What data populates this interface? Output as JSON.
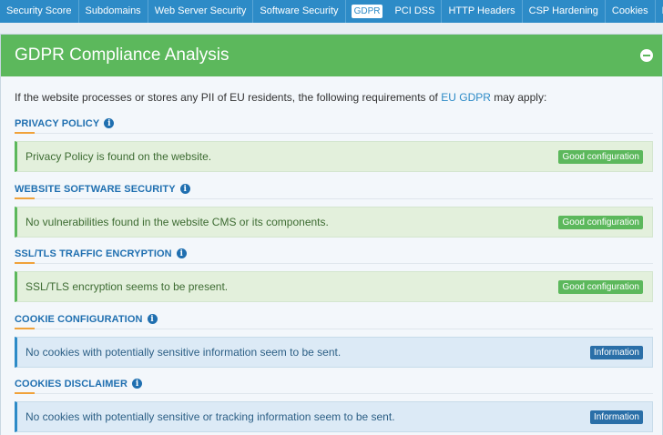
{
  "nav": [
    {
      "label": "Security Score",
      "active": false
    },
    {
      "label": "Subdomains",
      "active": false
    },
    {
      "label": "Web Server Security",
      "active": false
    },
    {
      "label": "Software Security",
      "active": false
    },
    {
      "label": "GDPR",
      "active": true
    },
    {
      "label": "PCI DSS",
      "active": false
    },
    {
      "label": "HTTP Headers",
      "active": false
    },
    {
      "label": "CSP Hardening",
      "active": false
    },
    {
      "label": "Cookies",
      "active": false
    },
    {
      "label": "External Content",
      "active": false
    }
  ],
  "panel": {
    "title": "GDPR Compliance Analysis",
    "intro_before": "If the website processes or stores any PII of EU residents, the following requirements of ",
    "intro_link": "EU GDPR",
    "intro_after": " may apply:"
  },
  "sections": [
    {
      "title": "PRIVACY POLICY",
      "text": "Privacy Policy is found on the website.",
      "badge": "Good configuration",
      "kind": "good"
    },
    {
      "title": "WEBSITE SOFTWARE SECURITY",
      "text": "No vulnerabilities found in the website CMS or its components.",
      "badge": "Good configuration",
      "kind": "good"
    },
    {
      "title": "SSL/TLS TRAFFIC ENCRYPTION",
      "text": "SSL/TLS encryption seems to be present.",
      "badge": "Good configuration",
      "kind": "good"
    },
    {
      "title": "COOKIE CONFIGURATION",
      "text": "No cookies with potentially sensitive information seem to be sent.",
      "badge": "Information",
      "kind": "info"
    },
    {
      "title": "COOKIES DISCLAIMER",
      "text": "No cookies with potentially sensitive or tracking information seem to be sent.",
      "badge": "Information",
      "kind": "info"
    }
  ],
  "colors": {
    "nav": "#2d8bc7",
    "header": "#5cb85c",
    "good": "#5cb85c",
    "info": "#2a6fa8",
    "accent": "#f0a23a"
  },
  "icons": {
    "collapse": "minus-circle-icon",
    "info": "info-circle-icon"
  }
}
